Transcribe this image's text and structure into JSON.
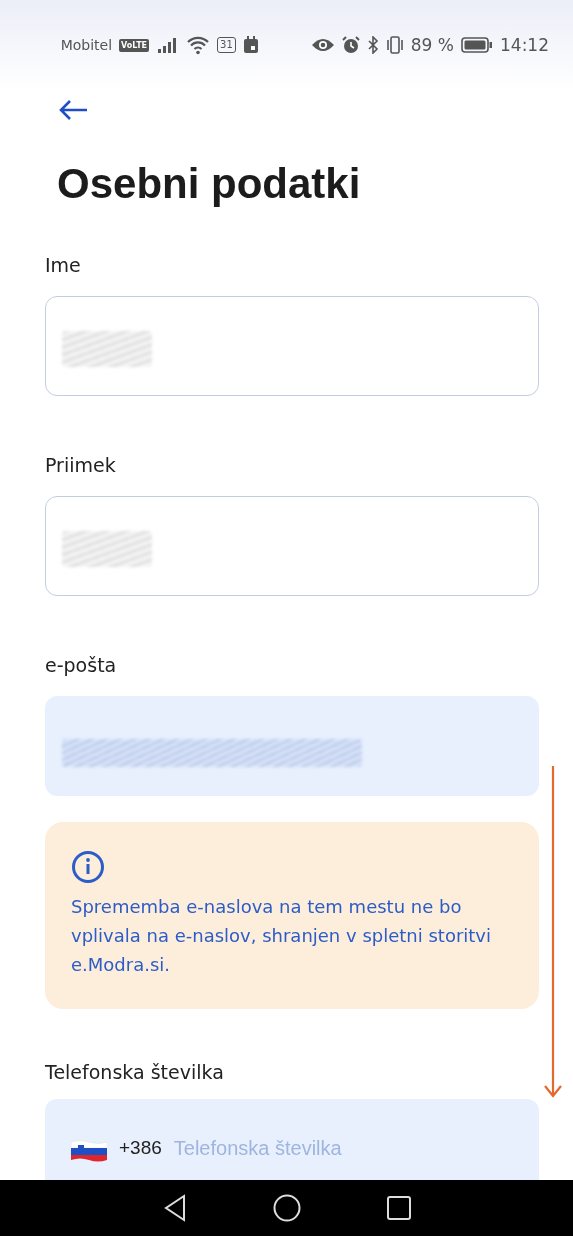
{
  "status_bar": {
    "carrier": "Mobitel",
    "network_badge": "VoLTE",
    "calendar_day": "31",
    "battery": "89 %",
    "time": "14:12"
  },
  "header": {
    "title": "Osebni podatki"
  },
  "sections": [
    {
      "kind": "field",
      "label": "Ime",
      "disabled": false,
      "redacted": true
    },
    {
      "kind": "field",
      "label": "Priimek",
      "disabled": false,
      "redacted": true
    },
    {
      "kind": "field",
      "label": "e-pošta",
      "disabled": true,
      "redacted": true
    },
    {
      "kind": "notice",
      "text": "Sprememba e-naslova na tem mestu ne bo vplivala na e-naslov, shranjen v spletni storitvi e.Modra.si."
    },
    {
      "kind": "phone",
      "label": "Telefonska številka",
      "prefix": "+386",
      "placeholder": "Telefonska številka",
      "disabled": true
    }
  ]
}
